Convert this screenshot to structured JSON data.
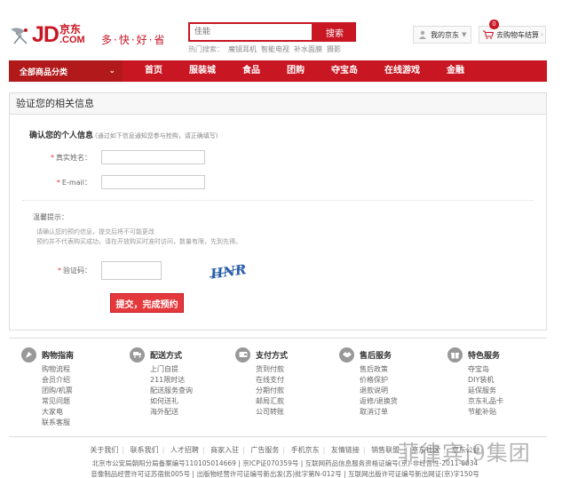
{
  "header": {
    "logo_main": "JD",
    "logo_cn": "京东",
    "logo_com": ".COM",
    "slogan": "多·快·好·省",
    "search_placeholder": "佳能",
    "search_button": "搜索",
    "hot_label": "热门搜索：",
    "hot_words": [
      "魔镜耳机",
      "智能电视",
      "补水面膜",
      "摄影"
    ],
    "my_jd": "我的京东",
    "cart": "去购物车结算",
    "cart_count": "0"
  },
  "nav": {
    "all_categories": "全部商品分类",
    "items": [
      "首页",
      "服装城",
      "食品",
      "团购",
      "夺宝岛",
      "在线游戏",
      "金融"
    ]
  },
  "form": {
    "box_title": "验证您的相关信息",
    "section_title": "确认您的个人信息",
    "section_note": "(通过如下信息通知您参与抢购，请正确填写)",
    "star": "*",
    "name_label": "真实姓名：",
    "email_label": "E-mail：",
    "tips_title": "温馨提示：",
    "tip1": "请确认您的预约信息，提交后将不可能更改",
    "tip2": "预约并不代表购买成功，请在开放购买时准时访问，数量有限，先到先得。",
    "captcha_label": "验证码：",
    "captcha_text": "HNR",
    "submit": "提交，完成预约"
  },
  "services": [
    {
      "title": "购物指南",
      "icon": "guide-icon",
      "links": [
        "购物流程",
        "会员介绍",
        "团购/机票",
        "常见问题",
        "大家电",
        "联系客服"
      ]
    },
    {
      "title": "配送方式",
      "icon": "truck-icon",
      "links": [
        "上门自提",
        "211限时达",
        "配送服务查询",
        "如何送礼",
        "海外配送"
      ]
    },
    {
      "title": "支付方式",
      "icon": "wallet-icon",
      "links": [
        "货到付款",
        "在线支付",
        "分期付款",
        "邮局汇款",
        "公司转账"
      ]
    },
    {
      "title": "售后服务",
      "icon": "handshake-icon",
      "links": [
        "售后政策",
        "价格保护",
        "退款说明",
        "返修/退换货",
        "取消订单"
      ]
    },
    {
      "title": "特色服务",
      "icon": "gift-icon",
      "links": [
        "夺宝岛",
        "DIY装机",
        "延保服务",
        "京东礼品卡",
        "节能补贴"
      ]
    }
  ],
  "footer": {
    "links": [
      "关于我们",
      "联系我们",
      "人才招聘",
      "商家入驻",
      "广告服务",
      "手机京东",
      "友情链接",
      "销售联盟",
      "京东社区",
      "京东公益"
    ],
    "copy1": "北京市公安局朝阳分局备案编号110105014669 | 京ICP证070359号 | 互联网药品信息服务资格证编号(京)-非经营性-2011-0034",
    "copy2": "音像制品经营许可证苏宿批005号 | 出版物经营许可证编号新出发(苏)批字第N-012号 | 互联网出版许可证编号新出网证(京)字150号",
    "watermark": "菲律宾j9集团"
  },
  "colors": {
    "brand": "#c81623",
    "button": "#e4393c"
  }
}
